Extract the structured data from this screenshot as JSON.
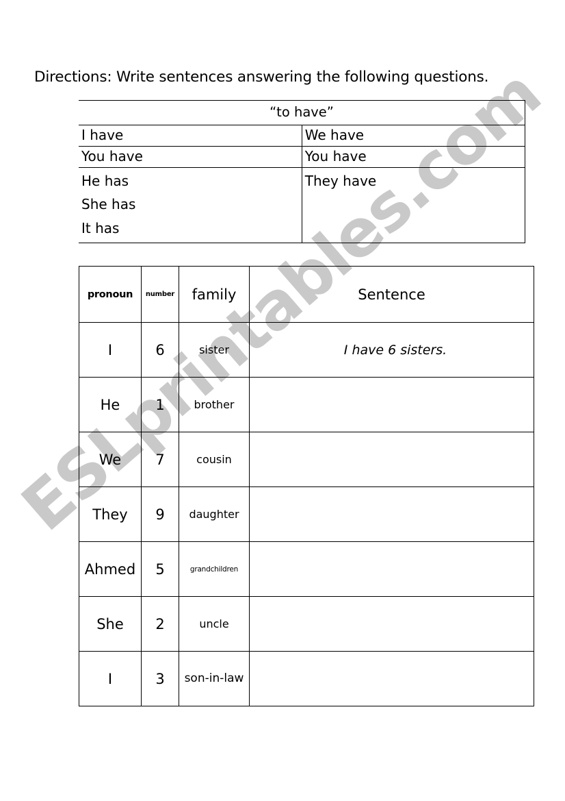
{
  "directions": "Directions:  Write sentences answering the following questions.",
  "watermark": {
    "text": "ESLprintables.com",
    "color": "#c9c9c9"
  },
  "have_table": {
    "title": "“to have”",
    "rows": [
      {
        "left": [
          "I have"
        ],
        "right": [
          "We have"
        ]
      },
      {
        "left": [
          "You have"
        ],
        "right": [
          "You have"
        ]
      },
      {
        "left": [
          "He has",
          "She has",
          "It has"
        ],
        "right": [
          "They have"
        ]
      }
    ],
    "singular_1": "I have",
    "plural_1": "We have",
    "singular_2": "You have",
    "plural_2": "You have",
    "singular_3a": "He has",
    "singular_3b": "She has",
    "singular_3c": "It has",
    "plural_3": "They have"
  },
  "exercise_table": {
    "headers": {
      "pronoun": "pronoun",
      "number": "number",
      "family": "family",
      "sentence": "Sentence"
    },
    "rows": [
      {
        "pronoun": "I",
        "number": "6",
        "family": "sister",
        "sentence": "I have 6 sisters."
      },
      {
        "pronoun": "He",
        "number": "1",
        "family": "brother",
        "sentence": ""
      },
      {
        "pronoun": "We",
        "number": "7",
        "family": "cousin",
        "sentence": ""
      },
      {
        "pronoun": "They",
        "number": "9",
        "family": "daughter",
        "sentence": ""
      },
      {
        "pronoun": "Ahmed",
        "number": "5",
        "family": "grandchildren",
        "sentence": ""
      },
      {
        "pronoun": "She",
        "number": "2",
        "family": "uncle",
        "sentence": ""
      },
      {
        "pronoun": "I",
        "number": "3",
        "family": "son-in-law",
        "sentence": ""
      }
    ]
  }
}
